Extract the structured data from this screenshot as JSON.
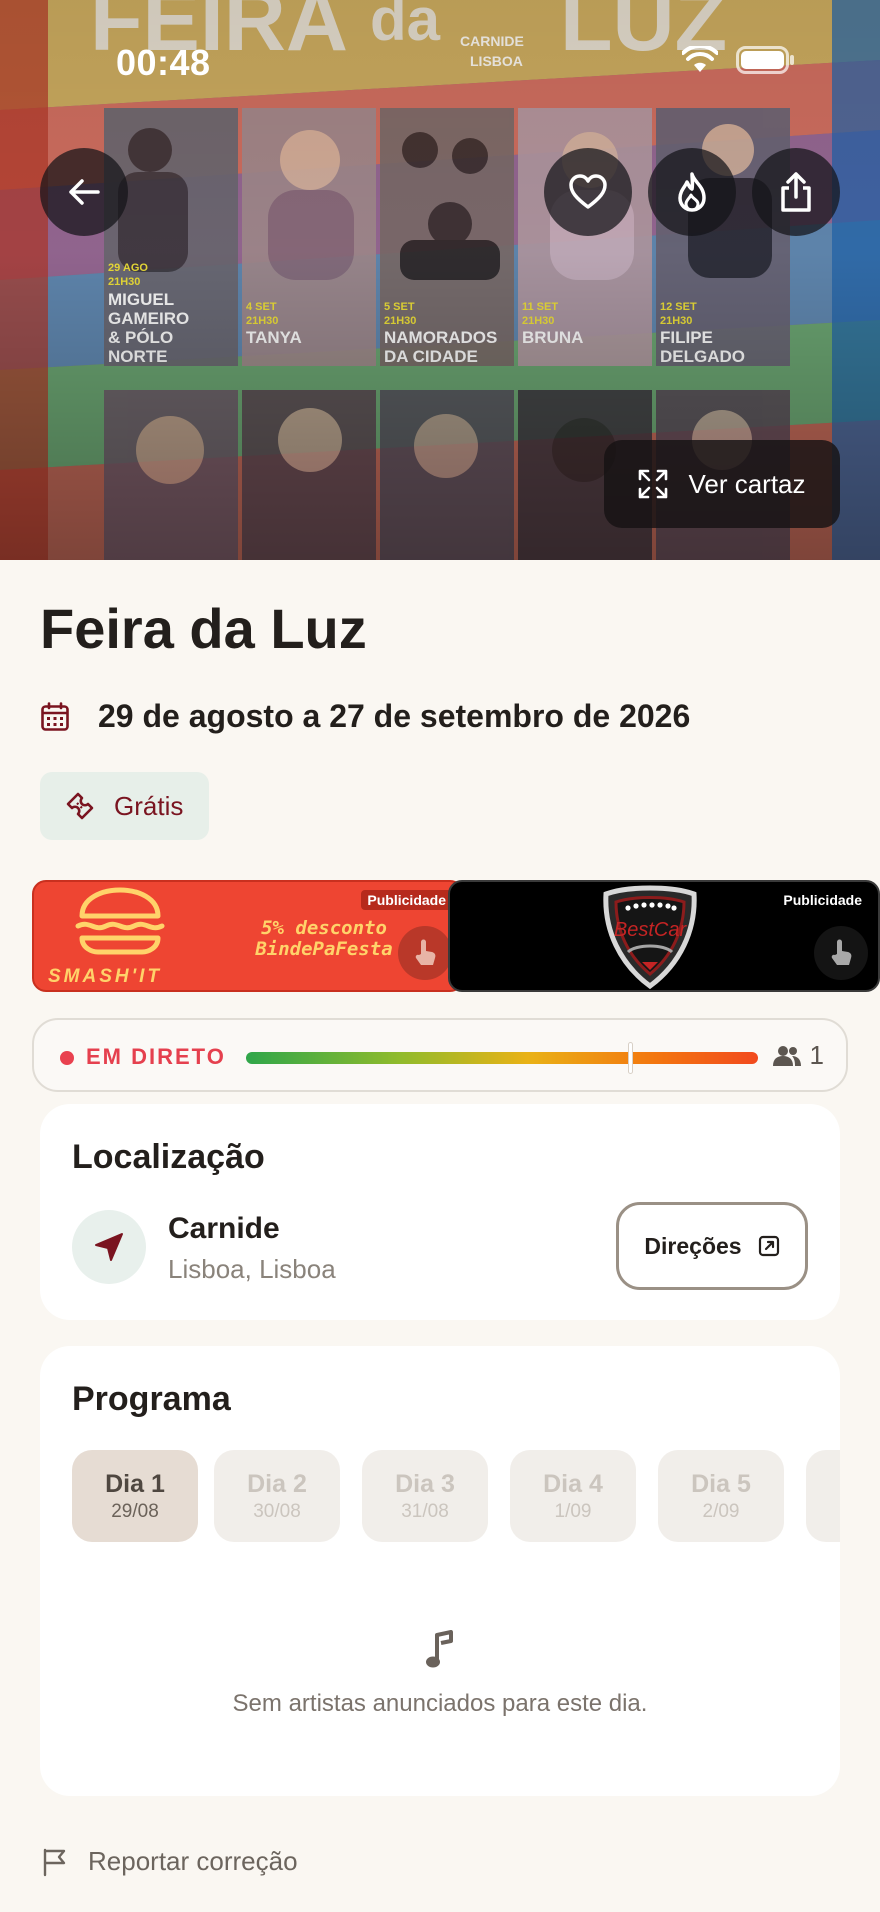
{
  "status_bar": {
    "time": "00:48"
  },
  "hero": {
    "poster_button_label": "Ver cartaz",
    "poster_text": {
      "header": "FEIRA da LUZ",
      "place": "CARNIDE LISBOA",
      "acts": [
        {
          "date": "29 AGO",
          "time": "21H30",
          "name": "MIGUEL GAMEIRO & PÓLO NORTE"
        },
        {
          "date": "4 SET",
          "time": "21H30",
          "name": "TANYA"
        },
        {
          "date": "5 SET",
          "time": "21H30",
          "name": "NAMORADOS DA CIDADE"
        },
        {
          "date": "11 SET",
          "time": "21H30",
          "name": "BRUNA"
        },
        {
          "date": "12 SET",
          "time": "21H30",
          "name": "FILIPE DELGADO"
        }
      ]
    }
  },
  "event": {
    "title": "Feira da Luz",
    "date_range": "29 de agosto a 27 de setembro de 2026",
    "price": "Grátis"
  },
  "ads": [
    {
      "tag": "Publicidade",
      "brand": "SMASH'IT",
      "promo": "5% desconto BindePaFesta"
    },
    {
      "tag": "Publicidade",
      "brand": "BestCar"
    }
  ],
  "live": {
    "label": "EM DIRETO",
    "count": "1",
    "level": 0.75
  },
  "location": {
    "heading": "Localização",
    "name": "Carnide",
    "sub": "Lisboa, Lisboa",
    "directions_label": "Direções"
  },
  "program": {
    "heading": "Programa",
    "days": [
      {
        "label": "Dia 1",
        "date": "29/08",
        "active": true
      },
      {
        "label": "Dia 2",
        "date": "30/08",
        "active": false
      },
      {
        "label": "Dia 3",
        "date": "31/08",
        "active": false
      },
      {
        "label": "Dia 4",
        "date": "1/09",
        "active": false
      },
      {
        "label": "Dia 5",
        "date": "2/09",
        "active": false
      }
    ],
    "empty_message": "Sem artistas anunciados para este dia."
  },
  "report_label": "Reportar correção",
  "colors": {
    "accent": "#7a1420",
    "live": "#e5404e",
    "page_bg": "#faf7f2",
    "card_bg": "#ffffff"
  }
}
